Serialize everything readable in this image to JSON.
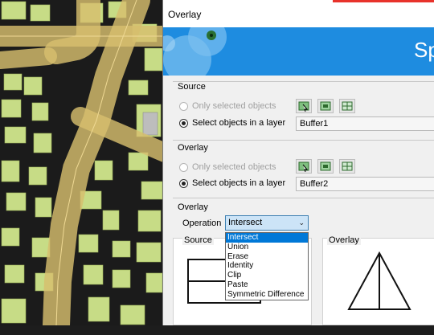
{
  "window": {
    "title": "Overlay",
    "banner_text": "Sp"
  },
  "source": {
    "heading": "Source",
    "option_selected_objects": "Only selected objects",
    "option_layer": "Select objects in a layer",
    "layer_value": "Buffer1"
  },
  "overlay": {
    "heading": "Overlay",
    "option_selected_objects": "Only selected objects",
    "option_layer": "Select objects in a layer",
    "layer_value": "Buffer2"
  },
  "overlay_op": {
    "heading": "Overlay",
    "operation_label": "Operation",
    "operation_value": "Intersect",
    "options": [
      "Intersect",
      "Union",
      "Erase",
      "Identity",
      "Clip",
      "Paste",
      "Symmetric Difference"
    ]
  },
  "preview": {
    "source_label": "Source",
    "overlay_label": "Overlay"
  },
  "colors": {
    "accent": "#1e8ce0",
    "selection": "#0078d7",
    "map_building": "#c7dc86",
    "map_road": "#d7be6e"
  }
}
